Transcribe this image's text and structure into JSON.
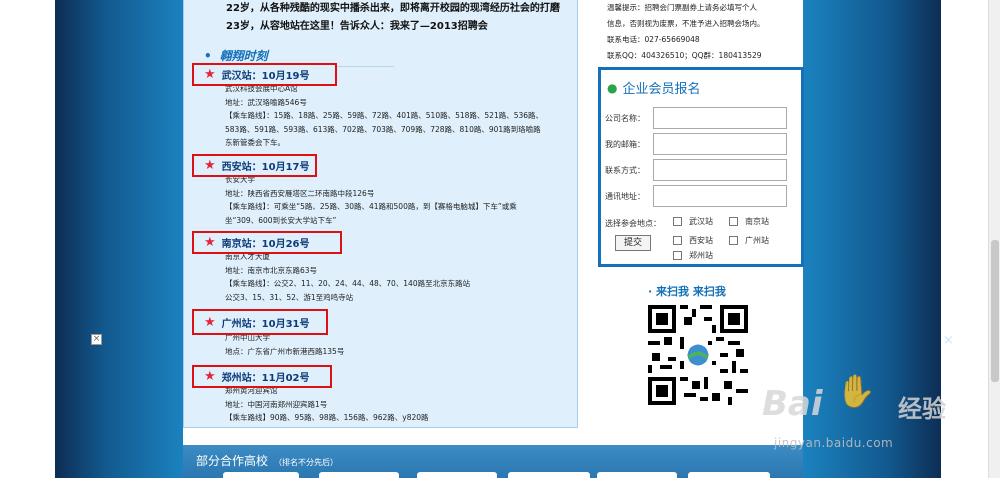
{
  "intro": {
    "line1": "22岁，从各种残酷的现实中播杀出来，即将离开校园的现湾经历社会的打磨",
    "line2": "23岁，从容地站在这里！告诉众人：我来了—2013招聘会"
  },
  "section_title": "翱翔时刻",
  "stations": [
    {
      "name": "武汉站：10月19号",
      "lines": [
        "武汉科技会展中心A馆",
        "地址：武汉珞喻路546号",
        "【乘车路线】：15路、18路、25路、59路、72路、401路、510路、518路、521路、536路、",
        "583路、591路、593路、613路、702路、703路、709路、728路、810路、901路到珞喻路",
        "东新管委会下车。"
      ]
    },
    {
      "name": "西安站：10月17号",
      "lines": [
        "长安大学",
        "地址：陕西省西安雁塔区二环南路中段126号",
        "【乘车路线】：可乘坐“5路、25路、30路、41路和500路，到【赛格电脑城】下车”或乘",
        "坐“309、600到长安大学站下车”"
      ]
    },
    {
      "name": "南京站：10月26号",
      "lines": [
        "南京人才大厦",
        "地址：南京市北京东路63号",
        "【乘车路线】：公交2、11、20、24、44、48、70、140路至北京东路站",
        "公交3、15、31、52、游1至鸡鸣寺站"
      ]
    },
    {
      "name": "广州站：10月31号",
      "lines": [
        "广州中山大学",
        "地点：广东省广州市新港西路135号"
      ]
    },
    {
      "name": "郑州站：11月02号",
      "lines": [
        "郑州黄河迎宾馆",
        "地址：中国河南郑州迎宾路1号",
        "【乘车路线】90路、95路、98路、156路、962路、y820路"
      ]
    }
  ],
  "notice": {
    "line1": "温馨提示：招聘会门票副券上请务必填写个人",
    "line2": "信息，否则视为废票，不准予进入招聘会场内。",
    "phone": "联系电话：027-65669048",
    "qq": "联系QQ：404326510；QQ群：180413529"
  },
  "registration": {
    "title": "企业会员报名",
    "fields": [
      {
        "label": "公司名称：",
        "value": ""
      },
      {
        "label": "我的邮箱：",
        "value": ""
      },
      {
        "label": "联系方式：",
        "value": ""
      },
      {
        "label": "通讯地址：",
        "value": ""
      }
    ],
    "location_label": "选择参会地点：",
    "locations": [
      "武汉站",
      "南京站",
      "西安站",
      "广州站",
      "郑州站"
    ],
    "submit_label": "提交"
  },
  "scan_text": "· 来扫我  来扫我",
  "partners": {
    "title": "部分合作高校",
    "note": "（排名不分先后）"
  },
  "watermark": {
    "brand": "Bai",
    "brand_tail": "经验",
    "url": "jingyan.baidu.com"
  },
  "colors": {
    "accent": "#1470b8",
    "highlight_border": "#dd1111",
    "panel_bg": "#dff0fc",
    "star": "#e1263b"
  },
  "icons": [
    "star-icon",
    "user-icon",
    "qr-code-icon",
    "close-icon",
    "paw-icon"
  ]
}
